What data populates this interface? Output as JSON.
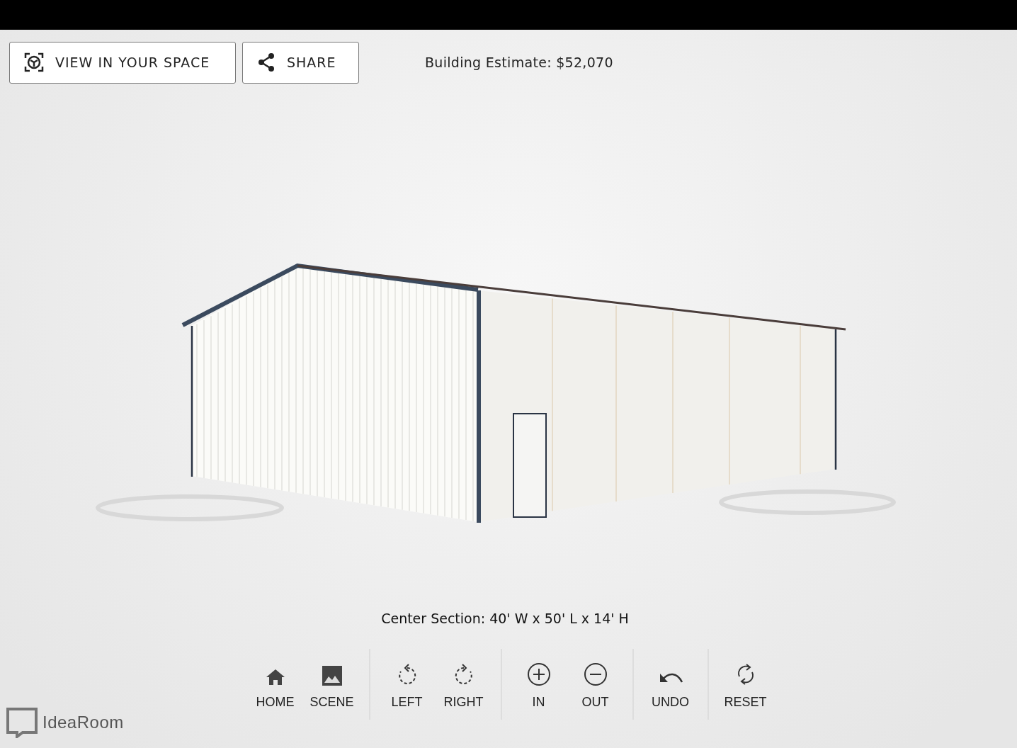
{
  "header": {
    "buttons": [
      {
        "kind": "ar",
        "label": "VIEW IN YOUR SPACE"
      },
      {
        "kind": "share",
        "label": "SHARE"
      }
    ],
    "estimate": "Building Estimate: $52,070"
  },
  "caption": "Center Section: 40' W x 50' L x 14' H",
  "toolbar": {
    "groups": [
      [
        {
          "kind": "home",
          "label": "HOME"
        },
        {
          "kind": "scene",
          "label": "SCENE"
        }
      ],
      [
        {
          "kind": "left",
          "label": "LEFT"
        },
        {
          "kind": "right",
          "label": "RIGHT"
        }
      ],
      [
        {
          "kind": "in",
          "label": "IN"
        },
        {
          "kind": "out",
          "label": "OUT"
        }
      ],
      [
        {
          "kind": "undo",
          "label": "UNDO"
        }
      ],
      [
        {
          "kind": "reset",
          "label": "RESET"
        }
      ]
    ]
  },
  "logo": {
    "text": "IdeaRoom"
  }
}
